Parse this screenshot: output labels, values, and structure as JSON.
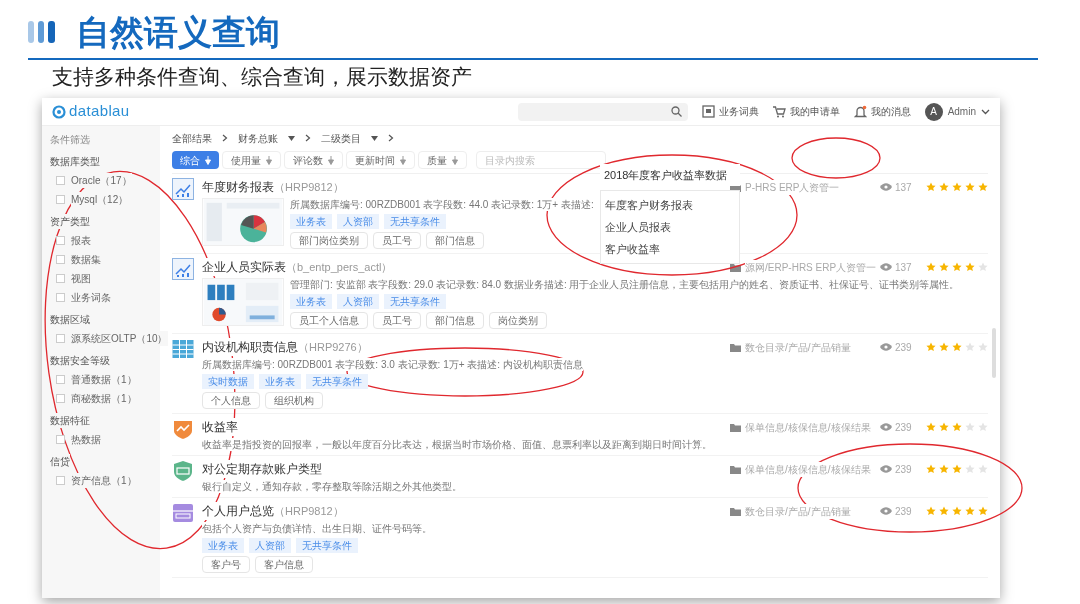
{
  "slide": {
    "title": "自然语义查询",
    "subtitle": "支持多种条件查询、综合查询，展示数据资产"
  },
  "app": {
    "logo": "datablau",
    "nav": [
      {
        "kind": "book",
        "label": "业务词典"
      },
      {
        "kind": "cart",
        "label": "我的申请单"
      },
      {
        "kind": "bell",
        "label": "我的消息"
      }
    ],
    "user": {
      "initial": "A",
      "name": "Admin"
    }
  },
  "sidebar": {
    "title": "条件筛选",
    "groups": [
      {
        "label": "数据库类型",
        "items": [
          {
            "label": "Oracle（17）",
            "checked": false
          },
          {
            "label": "Mysql（12）",
            "checked": false
          }
        ]
      },
      {
        "label": "资产类型",
        "items": [
          {
            "label": "报表",
            "checked": false
          },
          {
            "label": "数据集",
            "checked": false
          },
          {
            "label": "视图",
            "checked": false
          },
          {
            "label": "业务词条",
            "checked": false
          }
        ]
      },
      {
        "label": "数据区域",
        "items": [
          {
            "label": "源系统区OLTP（10）",
            "checked": false
          }
        ]
      },
      {
        "label": "数据安全等级",
        "items": [
          {
            "label": "普通数据（1）",
            "checked": false
          },
          {
            "label": "商秘数据（1）",
            "checked": false
          }
        ]
      },
      {
        "label": "数据特征",
        "items": [
          {
            "label": "热数据",
            "checked": false
          }
        ]
      },
      {
        "label": "信贷",
        "items": [
          {
            "label": "资产信息（1）",
            "checked": false
          }
        ]
      }
    ]
  },
  "breadcrumb": [
    {
      "label": "全部结果",
      "dropdown": false
    },
    {
      "label": "财务总账",
      "dropdown": true
    },
    {
      "label": "二级类目",
      "dropdown": true
    }
  ],
  "sort": [
    {
      "label": "综合",
      "selected": true
    },
    {
      "label": "使用量",
      "selected": false
    },
    {
      "label": "评论数",
      "selected": false
    },
    {
      "label": "更新时间",
      "selected": false
    },
    {
      "label": "质量",
      "selected": false
    }
  ],
  "catalog_search": {
    "placeholder": "目录内搜索"
  },
  "suggest": {
    "value": "2018年度客户收益率数据",
    "items": [
      "年度客户财务报表",
      "企业人员报表",
      "客户收益率"
    ]
  },
  "results": [
    {
      "kind": "report",
      "title": "年度财务报表",
      "code": "（HRP9812）",
      "meta": "所属数据库编号: 00RZDB001  表字段数: 44.0  表记录数: 1万+  表描述:",
      "tags": [
        "业务表",
        "人资部",
        "无共享条件"
      ],
      "chips": [
        "部门岗位类别",
        "员工号",
        "部门信息"
      ],
      "path": "P-HRS ERP人资管一",
      "views": "137",
      "stars": 5
    },
    {
      "kind": "report",
      "title": "企业人员实际表",
      "code": "（b_entp_pers_actl）",
      "meta": "管理部门: 安监部  表字段数: 29.0  表记录数: 84.0  数据业务描述: 用于企业人员注册信息，主要包括用户的姓名、资质证书、社保证号、证书类别等属性。",
      "tags": [
        "业务表",
        "人资部",
        "无共享条件"
      ],
      "chips": [
        "员工个人信息",
        "员工号",
        "部门信息",
        "岗位类别"
      ],
      "path": "源网/ERP-HRS ERP人资管一",
      "views": "137",
      "stars": 4
    },
    {
      "kind": "table",
      "title": "内设机构职责信息",
      "code": "（HRP9276）",
      "meta": "所属数据库编号: 00RZDB001  表字段数: 3.0  表记录数: 1万+  表描述: 内设机构职责信息",
      "tags": [
        "实时数据",
        "业务表",
        "无共享条件"
      ],
      "chips": [
        "个人信息",
        "组织机构"
      ],
      "path": "数仓目录/产品/产品销量",
      "views": "239",
      "stars": 3
    },
    {
      "kind": "metric",
      "title": "收益率",
      "meta": "收益率是指投资的回报率，一般以年度百分比表达，根据当时市场价格、面值、息票利率以及距离到期日时间计算。",
      "path": "保单信息/核保信息/核保结果",
      "views": "239",
      "stars": 3
    },
    {
      "kind": "term",
      "title": "对公定期存款账户类型",
      "meta": "银行自定义，通知存款，零存整取等除活期之外其他类型。",
      "path": "保单信息/核保信息/核保结果",
      "views": "239",
      "stars": 3
    },
    {
      "kind": "profile",
      "title": "个人用户总览",
      "code": "（HRP9812）",
      "meta": "包括个人资产与负债详情、出生日期、证件号码等。",
      "tags": [
        "业务表",
        "人资部",
        "无共享条件"
      ],
      "chips": [
        "客户号",
        "客户信息"
      ],
      "path": "数仓目录/产品/产品销量",
      "views": "239",
      "stars": 5
    }
  ]
}
